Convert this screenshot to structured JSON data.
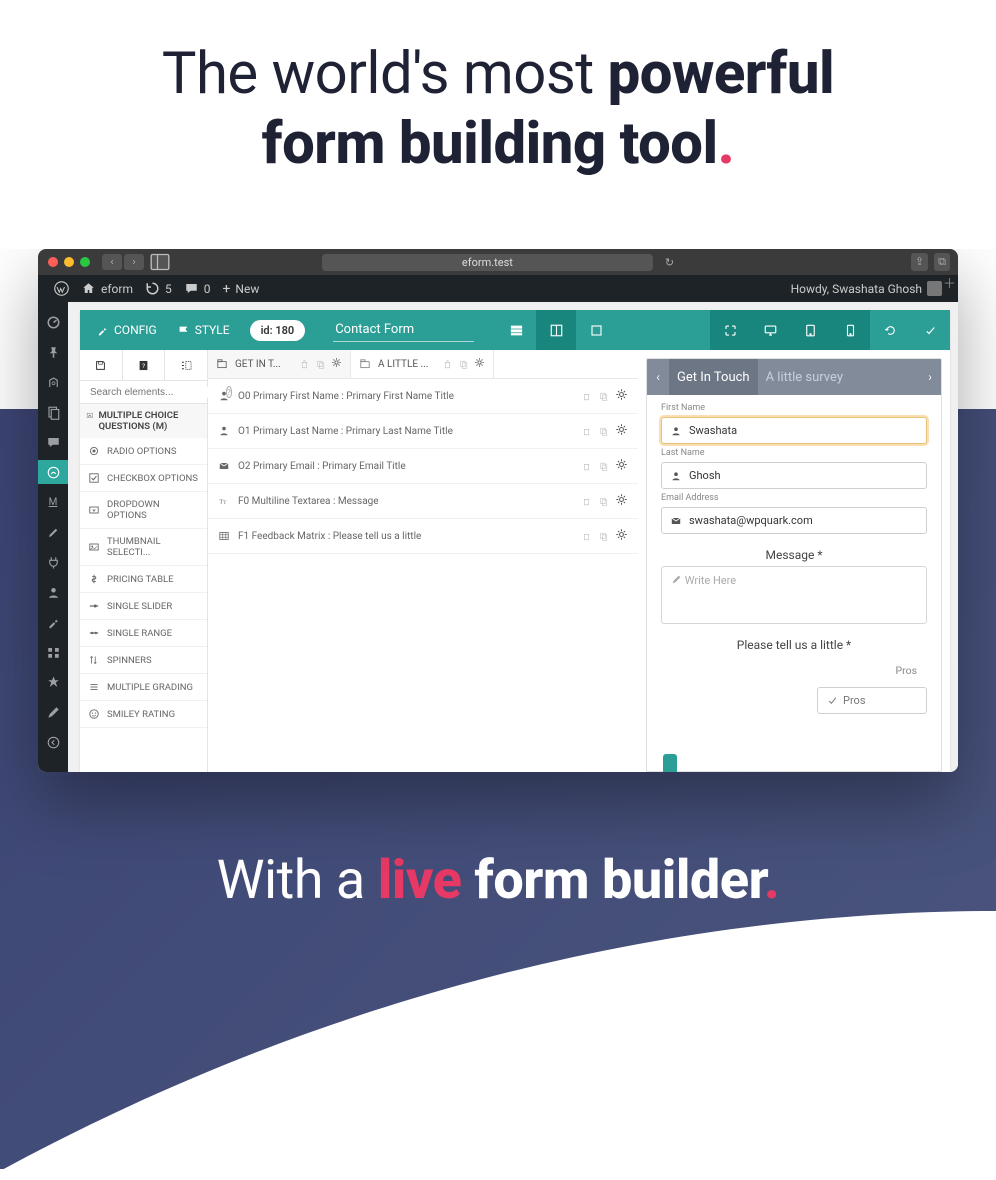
{
  "hero": {
    "line1_prefix": "The world's most ",
    "line1_strong": "powerful",
    "line2_strong": "form building tool"
  },
  "subhero": {
    "prefix": "With a ",
    "live": "live",
    "suffix": " form builder"
  },
  "browser": {
    "url": "eform.test"
  },
  "wpbar": {
    "site": "eform",
    "updates": "5",
    "comments": "0",
    "new": "New",
    "howdy": "Howdy, Swashata Ghosh"
  },
  "toolbar": {
    "config": "CONFIG",
    "style": "STYLE",
    "id": "id: 180",
    "form_name": "Contact Form"
  },
  "search": {
    "placeholder": "Search elements..."
  },
  "category": {
    "title": "MULTIPLE CHOICE QUESTIONS (M)"
  },
  "elements": [
    {
      "label": "RADIO OPTIONS"
    },
    {
      "label": "CHECKBOX OPTIONS"
    },
    {
      "label": "DROPDOWN OPTIONS"
    },
    {
      "label": "THUMBNAIL SELECTI..."
    },
    {
      "label": "PRICING TABLE"
    },
    {
      "label": "SINGLE SLIDER"
    },
    {
      "label": "SINGLE RANGE"
    },
    {
      "label": "SPINNERS"
    },
    {
      "label": "MULTIPLE GRADING"
    },
    {
      "label": "SMILEY RATING"
    }
  ],
  "pageTabs": [
    {
      "label": "GET IN T..."
    },
    {
      "label": "A LITTLE ..."
    }
  ],
  "rows": [
    {
      "label": "O0 Primary First Name : Primary First Name Title"
    },
    {
      "label": "O1 Primary Last Name : Primary Last Name Title"
    },
    {
      "label": "O2 Primary Email : Primary Email Title"
    },
    {
      "label": "F0 Multiline Textarea : Message"
    },
    {
      "label": "F1 Feedback Matrix : Please tell us a little"
    }
  ],
  "preview": {
    "tabs": [
      "Get In Touch",
      "A little survey"
    ],
    "first_name_label": "First Name",
    "first_name_value": "Swashata",
    "last_name_label": "Last Name",
    "last_name_value": "Ghosh",
    "email_label": "Email Address",
    "email_value": "swashata@wpquark.com",
    "message_label": "Message *",
    "message_placeholder": "Write Here",
    "tellus": "Please tell us a little *",
    "pros_header": "Pros",
    "pros_value": "Pros"
  }
}
